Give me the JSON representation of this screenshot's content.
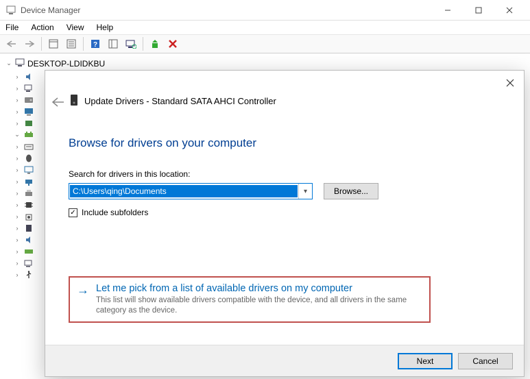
{
  "window": {
    "title": "Device Manager",
    "menus": {
      "file": "File",
      "action": "Action",
      "view": "View",
      "help": "Help"
    }
  },
  "tree": {
    "root": "DESKTOP-LDIDKBU"
  },
  "dialog": {
    "title": "Update Drivers - Standard SATA AHCI Controller",
    "heading": "Browse for drivers on your computer",
    "search_label": "Search for drivers in this location:",
    "path": "C:\\Users\\qing\\Documents",
    "browse": "Browse...",
    "include_subfolders": "Include subfolders",
    "option_title": "Let me pick from a list of available drivers on my computer",
    "option_desc": "This list will show available drivers compatible with the device, and all drivers in the same category as the device.",
    "next": "Next",
    "cancel": "Cancel"
  }
}
